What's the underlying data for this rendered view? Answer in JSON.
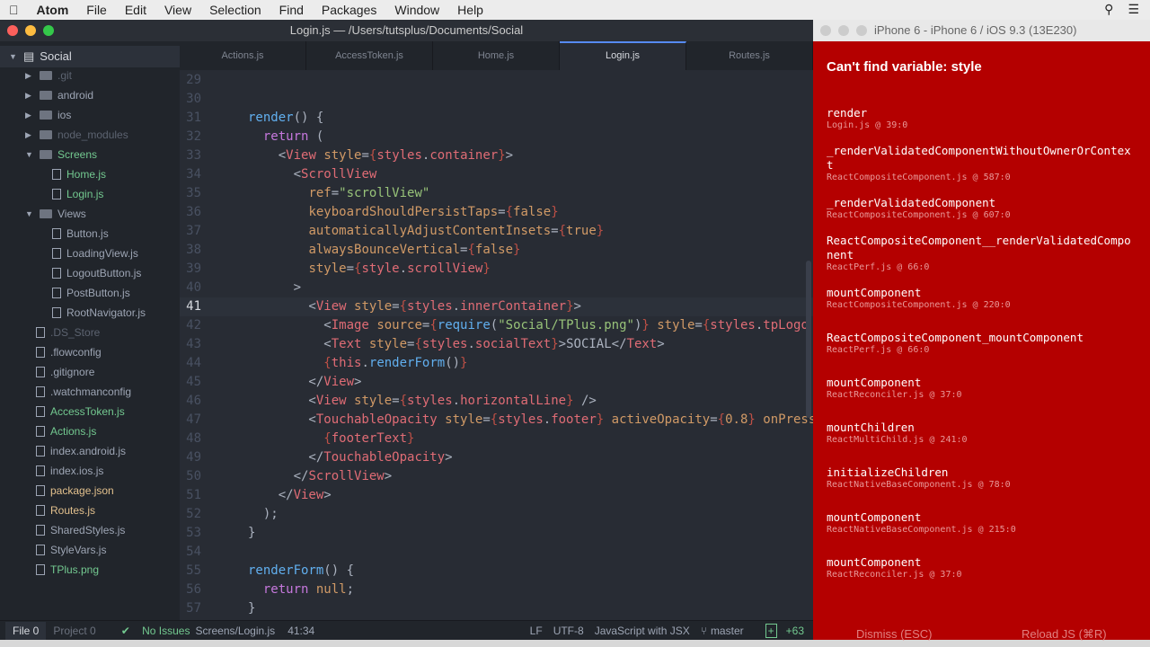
{
  "menubar": {
    "app": "Atom",
    "items": [
      "File",
      "Edit",
      "View",
      "Selection",
      "Find",
      "Packages",
      "Window",
      "Help"
    ]
  },
  "atom": {
    "title": "Login.js — /Users/tutsplus/Documents/Social"
  },
  "tabs": [
    {
      "label": "Actions.js",
      "active": false
    },
    {
      "label": "AccessToken.js",
      "active": false
    },
    {
      "label": "Home.js",
      "active": false
    },
    {
      "label": "Login.js",
      "active": true
    },
    {
      "label": "Routes.js",
      "active": false
    }
  ],
  "tree": [
    {
      "label": "Social",
      "depth": 0,
      "type": "root"
    },
    {
      "label": ".git",
      "depth": 1,
      "type": "folder",
      "dim": true
    },
    {
      "label": "android",
      "depth": 1,
      "type": "folder"
    },
    {
      "label": "ios",
      "depth": 1,
      "type": "folder"
    },
    {
      "label": "node_modules",
      "depth": 1,
      "type": "folder",
      "dim": true
    },
    {
      "label": "Screens",
      "depth": 1,
      "type": "folder",
      "open": true,
      "green": true
    },
    {
      "label": "Home.js",
      "depth": 2,
      "type": "file",
      "green": true
    },
    {
      "label": "Login.js",
      "depth": 2,
      "type": "file",
      "green": true
    },
    {
      "label": "Views",
      "depth": 1,
      "type": "folder",
      "open": true
    },
    {
      "label": "Button.js",
      "depth": 2,
      "type": "file"
    },
    {
      "label": "LoadingView.js",
      "depth": 2,
      "type": "file"
    },
    {
      "label": "LogoutButton.js",
      "depth": 2,
      "type": "file"
    },
    {
      "label": "PostButton.js",
      "depth": 2,
      "type": "file"
    },
    {
      "label": "RootNavigator.js",
      "depth": 2,
      "type": "file"
    },
    {
      "label": ".DS_Store",
      "depth": 1,
      "type": "file",
      "dim": true
    },
    {
      "label": ".flowconfig",
      "depth": 1,
      "type": "file"
    },
    {
      "label": ".gitignore",
      "depth": 1,
      "type": "file"
    },
    {
      "label": ".watchmanconfig",
      "depth": 1,
      "type": "file"
    },
    {
      "label": "AccessToken.js",
      "depth": 1,
      "type": "file",
      "green": true
    },
    {
      "label": "Actions.js",
      "depth": 1,
      "type": "file",
      "green": true
    },
    {
      "label": "index.android.js",
      "depth": 1,
      "type": "file"
    },
    {
      "label": "index.ios.js",
      "depth": 1,
      "type": "file"
    },
    {
      "label": "package.json",
      "depth": 1,
      "type": "file",
      "orange": true
    },
    {
      "label": "Routes.js",
      "depth": 1,
      "type": "file",
      "orange": true
    },
    {
      "label": "SharedStyles.js",
      "depth": 1,
      "type": "file"
    },
    {
      "label": "StyleVars.js",
      "depth": 1,
      "type": "file"
    },
    {
      "label": "TPlus.png",
      "depth": 1,
      "type": "file",
      "green": true
    }
  ],
  "code": {
    "current_line": 41,
    "lines": [
      {
        "n": "29",
        "t": []
      },
      {
        "n": "30",
        "t": []
      },
      {
        "n": "31",
        "t": [
          [
            "fn",
            "render"
          ],
          [
            "p",
            "() {"
          ]
        ]
      },
      {
        "n": "32",
        "t": [
          [
            "p",
            "  "
          ],
          [
            "kw",
            "return"
          ],
          [
            "p",
            " ("
          ]
        ]
      },
      {
        "n": "33",
        "t": [
          [
            "p",
            "    <"
          ],
          [
            "tag",
            "View"
          ],
          [
            "p",
            " "
          ],
          [
            "attr",
            "style"
          ],
          [
            "p",
            "="
          ],
          [
            "br",
            "{"
          ],
          [
            "prop",
            "styles"
          ],
          [
            "p",
            "."
          ],
          [
            "prop",
            "container"
          ],
          [
            "br",
            "}"
          ],
          [
            "p",
            ">"
          ]
        ]
      },
      {
        "n": "34",
        "t": [
          [
            "p",
            "      <"
          ],
          [
            "tag",
            "ScrollView"
          ]
        ]
      },
      {
        "n": "35",
        "t": [
          [
            "p",
            "        "
          ],
          [
            "attr",
            "ref"
          ],
          [
            "p",
            "="
          ],
          [
            "str",
            "\"scrollView\""
          ]
        ]
      },
      {
        "n": "36",
        "t": [
          [
            "p",
            "        "
          ],
          [
            "attr",
            "keyboardShouldPersistTaps"
          ],
          [
            "p",
            "="
          ],
          [
            "br",
            "{"
          ],
          [
            "attr",
            "false"
          ],
          [
            "br",
            "}"
          ]
        ]
      },
      {
        "n": "37",
        "t": [
          [
            "p",
            "        "
          ],
          [
            "attr",
            "automaticallyAdjustContentInsets"
          ],
          [
            "p",
            "="
          ],
          [
            "br",
            "{"
          ],
          [
            "attr",
            "true"
          ],
          [
            "br",
            "}"
          ]
        ]
      },
      {
        "n": "38",
        "t": [
          [
            "p",
            "        "
          ],
          [
            "attr",
            "alwaysBounceVertical"
          ],
          [
            "p",
            "="
          ],
          [
            "br",
            "{"
          ],
          [
            "attr",
            "false"
          ],
          [
            "br",
            "}"
          ]
        ]
      },
      {
        "n": "39",
        "t": [
          [
            "p",
            "        "
          ],
          [
            "attr",
            "style"
          ],
          [
            "p",
            "="
          ],
          [
            "br",
            "{"
          ],
          [
            "prop",
            "style"
          ],
          [
            "p",
            "."
          ],
          [
            "prop",
            "scrollView"
          ],
          [
            "br",
            "}"
          ]
        ]
      },
      {
        "n": "40",
        "t": [
          [
            "p",
            "      >"
          ]
        ]
      },
      {
        "n": "41",
        "t": [
          [
            "p",
            "        <"
          ],
          [
            "tag",
            "View"
          ],
          [
            "p",
            " "
          ],
          [
            "attr",
            "style"
          ],
          [
            "p",
            "="
          ],
          [
            "br",
            "{"
          ],
          [
            "prop",
            "styles"
          ],
          [
            "p",
            "."
          ],
          [
            "prop",
            "innerContainer"
          ],
          [
            "br",
            "}"
          ],
          [
            "p",
            ">"
          ]
        ]
      },
      {
        "n": "42",
        "t": [
          [
            "p",
            "          <"
          ],
          [
            "tag",
            "Image"
          ],
          [
            "p",
            " "
          ],
          [
            "attr",
            "source"
          ],
          [
            "p",
            "="
          ],
          [
            "br",
            "{"
          ],
          [
            "fn",
            "require"
          ],
          [
            "p",
            "("
          ],
          [
            "str",
            "\"Social/TPlus.png\""
          ],
          [
            "p",
            ")"
          ],
          [
            "br",
            "}"
          ],
          [
            "p",
            " "
          ],
          [
            "attr",
            "style"
          ],
          [
            "p",
            "="
          ],
          [
            "br",
            "{"
          ],
          [
            "prop",
            "styles"
          ],
          [
            "p",
            "."
          ],
          [
            "prop",
            "tpLogo"
          ]
        ]
      },
      {
        "n": "43",
        "t": [
          [
            "p",
            "          <"
          ],
          [
            "tag",
            "Text"
          ],
          [
            "p",
            " "
          ],
          [
            "attr",
            "style"
          ],
          [
            "p",
            "="
          ],
          [
            "br",
            "{"
          ],
          [
            "prop",
            "styles"
          ],
          [
            "p",
            "."
          ],
          [
            "prop",
            "socialText"
          ],
          [
            "br",
            "}"
          ],
          [
            "p",
            ">SOCIAL</"
          ],
          [
            "tag",
            "Text"
          ],
          [
            "p",
            ">"
          ]
        ]
      },
      {
        "n": "44",
        "t": [
          [
            "p",
            "          "
          ],
          [
            "br",
            "{"
          ],
          [
            "prop",
            "this"
          ],
          [
            "p",
            "."
          ],
          [
            "fn",
            "renderForm"
          ],
          [
            "p",
            "()"
          ],
          [
            "br",
            "}"
          ]
        ]
      },
      {
        "n": "45",
        "t": [
          [
            "p",
            "        </"
          ],
          [
            "tag",
            "View"
          ],
          [
            "p",
            ">"
          ]
        ]
      },
      {
        "n": "46",
        "t": [
          [
            "p",
            "        <"
          ],
          [
            "tag",
            "View"
          ],
          [
            "p",
            " "
          ],
          [
            "attr",
            "style"
          ],
          [
            "p",
            "="
          ],
          [
            "br",
            "{"
          ],
          [
            "prop",
            "styles"
          ],
          [
            "p",
            "."
          ],
          [
            "prop",
            "horizontalLine"
          ],
          [
            "br",
            "}"
          ],
          [
            "p",
            " />"
          ]
        ]
      },
      {
        "n": "47",
        "t": [
          [
            "p",
            "        <"
          ],
          [
            "tag",
            "TouchableOpacity"
          ],
          [
            "p",
            " "
          ],
          [
            "attr",
            "style"
          ],
          [
            "p",
            "="
          ],
          [
            "br",
            "{"
          ],
          [
            "prop",
            "styles"
          ],
          [
            "p",
            "."
          ],
          [
            "prop",
            "footer"
          ],
          [
            "br",
            "}"
          ],
          [
            "p",
            " "
          ],
          [
            "attr",
            "activeOpacity"
          ],
          [
            "p",
            "="
          ],
          [
            "br",
            "{"
          ],
          [
            "attr",
            "0.8"
          ],
          [
            "br",
            "}"
          ],
          [
            "p",
            " "
          ],
          [
            "attr",
            "onPress"
          ]
        ]
      },
      {
        "n": "48",
        "t": [
          [
            "p",
            "          "
          ],
          [
            "br",
            "{"
          ],
          [
            "prop",
            "footerText"
          ],
          [
            "br",
            "}"
          ]
        ]
      },
      {
        "n": "49",
        "t": [
          [
            "p",
            "        </"
          ],
          [
            "tag",
            "TouchableOpacity"
          ],
          [
            "p",
            ">"
          ]
        ]
      },
      {
        "n": "50",
        "t": [
          [
            "p",
            "      </"
          ],
          [
            "tag",
            "ScrollView"
          ],
          [
            "p",
            ">"
          ]
        ]
      },
      {
        "n": "51",
        "t": [
          [
            "p",
            "    </"
          ],
          [
            "tag",
            "View"
          ],
          [
            "p",
            ">"
          ]
        ]
      },
      {
        "n": "52",
        "t": [
          [
            "p",
            "  );"
          ]
        ]
      },
      {
        "n": "53",
        "t": [
          [
            "p",
            "}"
          ]
        ]
      },
      {
        "n": "54",
        "t": []
      },
      {
        "n": "55",
        "t": [
          [
            "fn",
            "renderForm"
          ],
          [
            "p",
            "() {"
          ]
        ]
      },
      {
        "n": "56",
        "t": [
          [
            "p",
            "  "
          ],
          [
            "kw",
            "return"
          ],
          [
            "p",
            " "
          ],
          [
            "attr",
            "null"
          ],
          [
            "p",
            ";"
          ]
        ]
      },
      {
        "n": "57",
        "t": [
          [
            "p",
            "}"
          ]
        ]
      }
    ]
  },
  "status": {
    "file": "File 0",
    "project": "Project 0",
    "issues": "No Issues",
    "path": "Screens/Login.js",
    "cursor": "41:34",
    "eol": "LF",
    "encoding": "UTF-8",
    "grammar": "JavaScript with JSX",
    "branch": "master",
    "diff": "+63"
  },
  "simulator": {
    "title": "iPhone 6 - iPhone 6 / iOS 9.3 (13E230)",
    "error": "Can't find variable: style",
    "frames": [
      {
        "fn": "render",
        "loc": "Login.js @ 39:0"
      },
      {
        "fn": "_renderValidatedComponentWithoutOwnerOrContext",
        "loc": "ReactCompositeComponent.js @ 587:0"
      },
      {
        "fn": "_renderValidatedComponent",
        "loc": "ReactCompositeComponent.js @ 607:0"
      },
      {
        "fn": "ReactCompositeComponent__renderValidatedComponent",
        "loc": "ReactPerf.js @ 66:0"
      },
      {
        "fn": "mountComponent",
        "loc": "ReactCompositeComponent.js @ 220:0"
      },
      {
        "fn": "ReactCompositeComponent_mountComponent",
        "loc": "ReactPerf.js @ 66:0"
      },
      {
        "fn": "mountComponent",
        "loc": "ReactReconciler.js @ 37:0"
      },
      {
        "fn": "mountChildren",
        "loc": "ReactMultiChild.js @ 241:0"
      },
      {
        "fn": "initializeChildren",
        "loc": "ReactNativeBaseComponent.js @ 78:0"
      },
      {
        "fn": "mountComponent",
        "loc": "ReactNativeBaseComponent.js @ 215:0"
      },
      {
        "fn": "mountComponent",
        "loc": "ReactReconciler.js @ 37:0"
      }
    ],
    "dismiss": "Dismiss (ESC)",
    "reload": "Reload JS (⌘R)"
  }
}
